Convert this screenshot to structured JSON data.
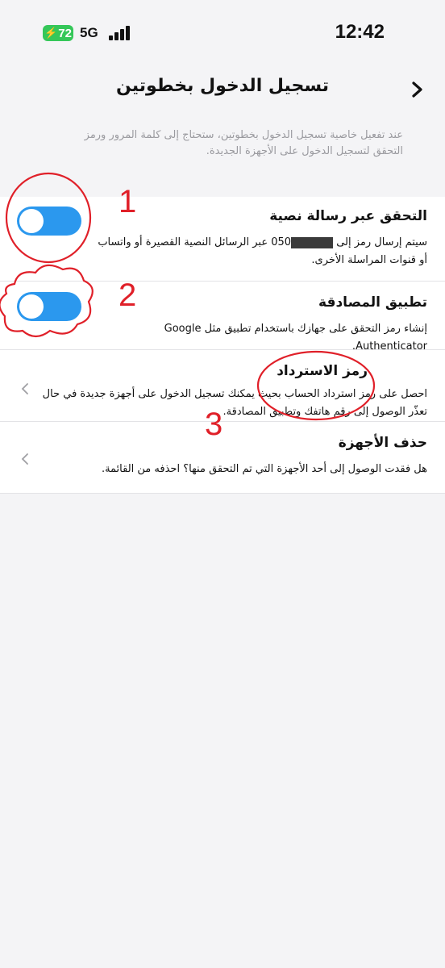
{
  "status_bar": {
    "battery": "72",
    "network": "5G",
    "time": "12:42"
  },
  "header": {
    "title": "تسجيل الدخول بخطوتين"
  },
  "intro": "عند تفعيل خاصية تسجيل الدخول بخطوتين، ستحتاج إلى كلمة المرور ورمز التحقق لتسجيل الدخول على الأجهزة الجديدة.",
  "options": {
    "sms": {
      "title": "التحقق عبر رسالة نصية",
      "desc_start": "سيتم إرسال رمز إلى",
      "phone_prefix": "050",
      "desc_end": "عبر الرسائل النصية القصيرة أو واتساب أو قنوات المراسلة الأخرى.",
      "enabled": true
    },
    "auth_app": {
      "title": "تطبيق المصادقة",
      "desc": "إنشاء رمز التحقق على جهازك باستخدام تطبيق مثل Google Authenticator.",
      "enabled": true
    },
    "recovery": {
      "title": "رمز الاسترداد",
      "desc": "احصل على رمز استرداد الحساب بحيث يمكنك تسجيل الدخول على أجهزة جديدة في حال تعذّر الوصول إلى رقم هاتفك وتطبيق المصادقة."
    },
    "remove_devices": {
      "title": "حذف الأجهزة",
      "desc": "هل فقدت الوصول إلى أحد الأجهزة التي تم التحقق منها؟ احذفه من القائمة."
    }
  },
  "annotations": {
    "one": "1",
    "two": "2",
    "three": "3",
    "color": "#e02029"
  },
  "colors": {
    "toggle_on": "#2b98ee",
    "battery": "#35c759"
  }
}
